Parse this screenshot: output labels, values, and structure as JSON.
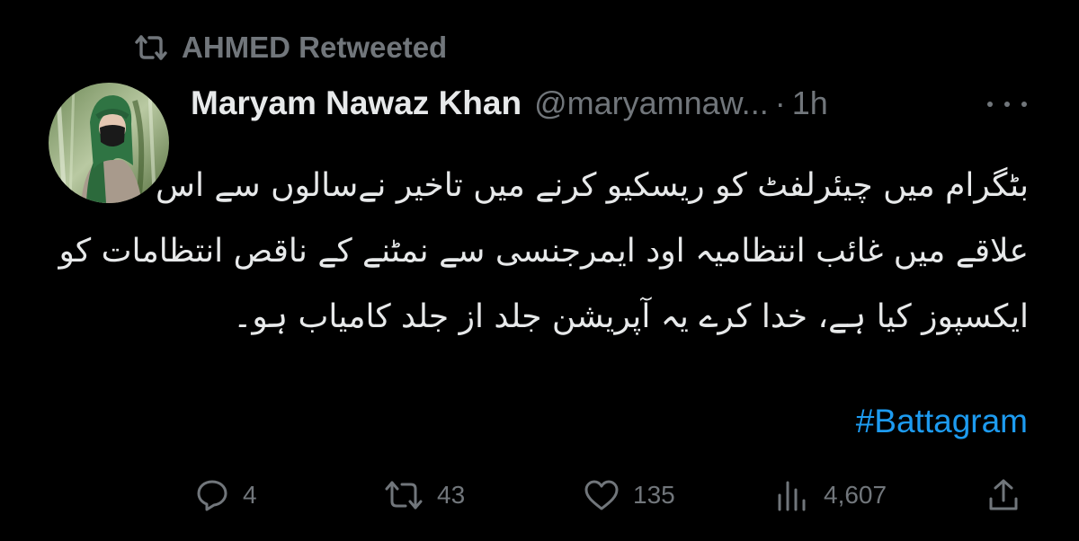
{
  "retweet_banner": {
    "icon": "retweet-icon",
    "text": "AHMED Retweeted"
  },
  "author": {
    "display_name": "Maryam Nawaz Khan",
    "handle": "@maryamnaw...",
    "separator": "·",
    "time": "1h",
    "avatar": "avatar-photo"
  },
  "tweet": {
    "lines": [
      "بٹگرام میں چیئرلفٹ کو ریسکیو کرنے میں تاخیر نےسالوں سے اس",
      "علاقے میں غائب انتظامیہ اود ایمرجنسی سے نمٹنے کے ناقص انتظامات کو",
      "ایکسپوز کیا ہے، خدا کرے یہ آپریشن جلد از جلد کامیاب ہو۔"
    ],
    "hashtag": "#Battagram"
  },
  "actions": {
    "reply": {
      "icon": "reply-icon",
      "count": "4"
    },
    "retweet": {
      "icon": "retweet-icon",
      "count": "43"
    },
    "like": {
      "icon": "heart-icon",
      "count": "135"
    },
    "views": {
      "icon": "views-icon",
      "count": "4,607"
    },
    "share": {
      "icon": "share-icon"
    }
  },
  "colors": {
    "background": "#000000",
    "primary_text": "#e7e9ea",
    "secondary_text": "#71767b",
    "link": "#1d9bf0"
  }
}
